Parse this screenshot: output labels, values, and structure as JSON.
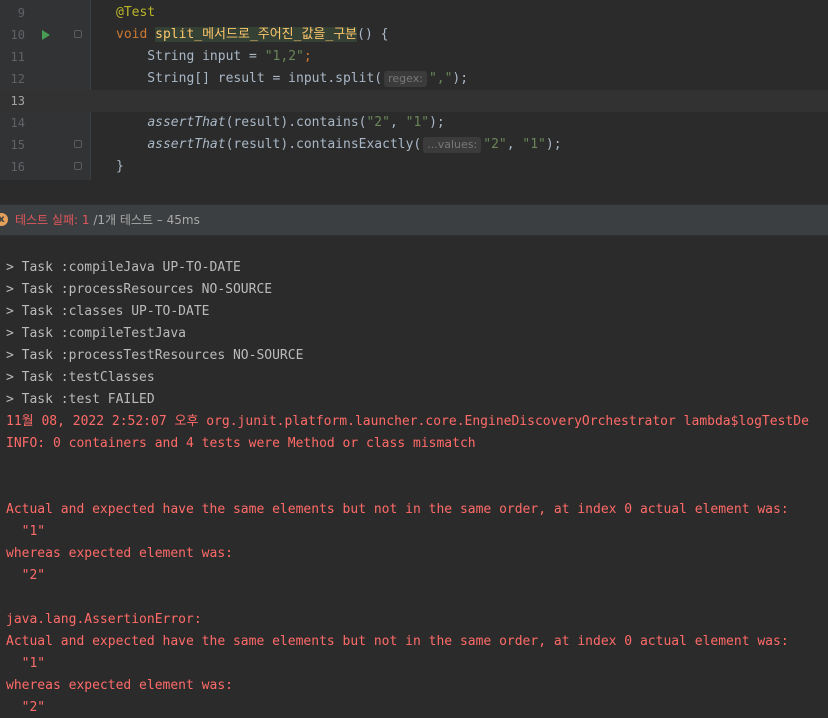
{
  "editor": {
    "lines": [
      {
        "number": "9",
        "parts": [
          [
            "@Test",
            "ann"
          ]
        ]
      },
      {
        "number": "10",
        "parts": [
          [
            "void ",
            "kw"
          ],
          [
            "split_메서드로_주어진_값을_구분",
            "method-hl"
          ],
          [
            "() {",
            ""
          ]
        ]
      },
      {
        "number": "11",
        "parts": [
          [
            "    String input = ",
            ""
          ],
          [
            "\"1,2\"",
            "str"
          ],
          [
            ";",
            "kw"
          ]
        ]
      },
      {
        "number": "12",
        "parts": [
          [
            "    String[] result = input.split(",
            ""
          ],
          [
            "regex:",
            "hint"
          ],
          [
            "\",\"",
            "str"
          ],
          [
            ");",
            ""
          ]
        ]
      },
      {
        "number": "13",
        "parts": [
          [
            "",
            ""
          ]
        ]
      },
      {
        "number": "14",
        "parts": [
          [
            "    ",
            ""
          ],
          [
            "assertThat",
            "italic"
          ],
          [
            "(result).contains(",
            ""
          ],
          [
            "\"2\"",
            "str"
          ],
          [
            ", ",
            ""
          ],
          [
            "\"1\"",
            "str"
          ],
          [
            ");",
            ""
          ]
        ]
      },
      {
        "number": "15",
        "parts": [
          [
            "    ",
            ""
          ],
          [
            "assertThat",
            "italic"
          ],
          [
            "(result).containsExactly(",
            ""
          ],
          [
            "...values:",
            "hint"
          ],
          [
            "\"2\"",
            "str"
          ],
          [
            ", ",
            ""
          ],
          [
            "\"1\"",
            "str"
          ],
          [
            ");",
            ""
          ]
        ]
      },
      {
        "number": "16",
        "parts": [
          [
            "}",
            ""
          ]
        ]
      }
    ]
  },
  "status": {
    "fail_label": "테스트 실패: 1",
    "rest_label": " /1개 테스트 – 45ms",
    "icon": "x"
  },
  "console": {
    "lines": [
      {
        "text": "> Task :compileJava UP-TO-DATE",
        "style": "gray"
      },
      {
        "text": "> Task :processResources NO-SOURCE",
        "style": "gray"
      },
      {
        "text": "> Task :classes UP-TO-DATE",
        "style": "gray"
      },
      {
        "text": "> Task :compileTestJava",
        "style": "gray"
      },
      {
        "text": "> Task :processTestResources NO-SOURCE",
        "style": "gray"
      },
      {
        "text": "> Task :testClasses",
        "style": "gray"
      },
      {
        "text": "> Task :test FAILED",
        "style": "gray"
      },
      {
        "text": "11월 08, 2022 2:52:07 오후 org.junit.platform.launcher.core.EngineDiscoveryOrchestrator lambda$logTestDe",
        "style": "red"
      },
      {
        "text": "INFO: 0 containers and 4 tests were Method or class mismatch",
        "style": "red"
      },
      {
        "text": "",
        "style": "red"
      },
      {
        "text": "",
        "style": "red"
      },
      {
        "text": "Actual and expected have the same elements but not in the same order, at index 0 actual element was:",
        "style": "red"
      },
      {
        "text": "  \"1\"",
        "style": "red"
      },
      {
        "text": "whereas expected element was:",
        "style": "red"
      },
      {
        "text": "  \"2\"",
        "style": "red"
      },
      {
        "text": "",
        "style": "red"
      },
      {
        "text": "java.lang.AssertionError:",
        "style": "red"
      },
      {
        "text": "Actual and expected have the same elements but not in the same order, at index 0 actual element was:",
        "style": "red"
      },
      {
        "text": "  \"1\"",
        "style": "red"
      },
      {
        "text": "whereas expected element was:",
        "style": "red"
      },
      {
        "text": "  \"2\"",
        "style": "red"
      }
    ]
  }
}
